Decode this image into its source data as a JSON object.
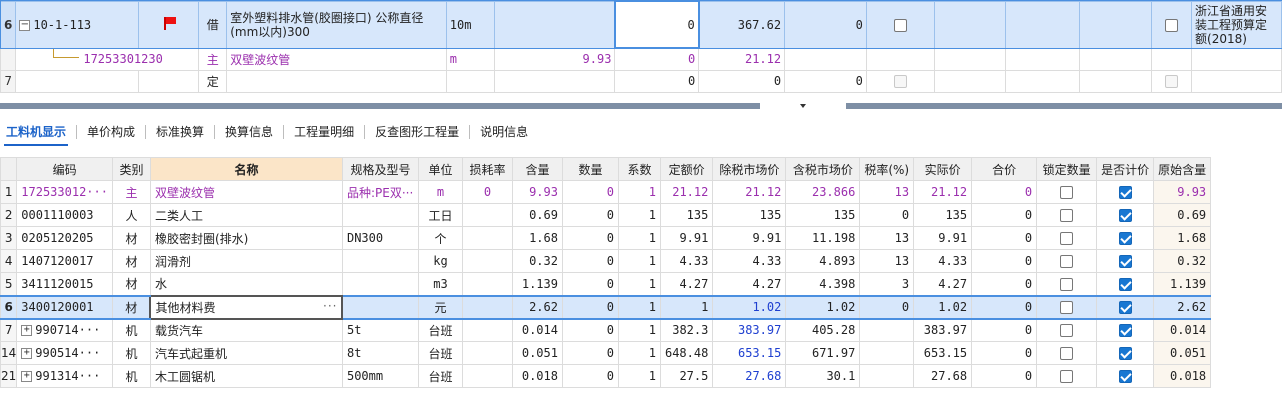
{
  "top_rows": [
    {
      "rowno": "6",
      "code": "10-1-113",
      "type": "借",
      "name": "室外塑料排水管(胶圈接口) 公称直径(mm以内)300",
      "unit": "10m",
      "qty": "",
      "val_a": "0",
      "val_b": "367.62",
      "val_c": "0",
      "std": "浙江省通用安装工程预算定额(2018)"
    },
    {
      "rowno": "",
      "code": "17253301230",
      "type": "主",
      "name": "双壁波纹管",
      "unit": "m",
      "qty": "9.93",
      "val_a": "0",
      "val_b": "21.12",
      "val_c": ""
    },
    {
      "rowno": "7",
      "code": "",
      "type": "定",
      "name": "",
      "unit": "",
      "qty": "",
      "val_a": "0",
      "val_b": "0",
      "val_c": "0"
    }
  ],
  "tabs": [
    "工料机显示",
    "单价构成",
    "标准换算",
    "换算信息",
    "工程量明细",
    "反查图形工程量",
    "说明信息"
  ],
  "columns": [
    "编码",
    "类别",
    "名称",
    "规格及型号",
    "单位",
    "损耗率",
    "含量",
    "数量",
    "系数",
    "定额价",
    "除税市场价",
    "含税市场价",
    "税率(%)",
    "实际价",
    "合价",
    "锁定数量",
    "是否计价",
    "原始含量"
  ],
  "rows": [
    {
      "no": "1",
      "code": "172533012···",
      "cat": "主",
      "name": "双壁波纹管",
      "spec": "品种:PE双···",
      "unit": "m",
      "loss": "0",
      "content": "9.93",
      "qty": "0",
      "coef": "1",
      "quota": "21.12",
      "ex_tax": "21.12",
      "in_tax": "23.866",
      "tax": "13",
      "actual": "21.12",
      "total": "0",
      "orig": "9.93"
    },
    {
      "no": "2",
      "code": "0001110003",
      "cat": "人",
      "name": "二类人工",
      "spec": "",
      "unit": "工日",
      "loss": "",
      "content": "0.69",
      "qty": "0",
      "coef": "1",
      "quota": "135",
      "ex_tax": "135",
      "in_tax": "135",
      "tax": "0",
      "actual": "135",
      "total": "0",
      "orig": "0.69"
    },
    {
      "no": "3",
      "code": "0205120205",
      "cat": "材",
      "name": "橡胶密封圈(排水)",
      "spec": "DN300",
      "unit": "个",
      "loss": "",
      "content": "1.68",
      "qty": "0",
      "coef": "1",
      "quota": "9.91",
      "ex_tax": "9.91",
      "in_tax": "11.198",
      "tax": "13",
      "actual": "9.91",
      "total": "0",
      "orig": "1.68"
    },
    {
      "no": "4",
      "code": "1407120017",
      "cat": "材",
      "name": "润滑剂",
      "spec": "",
      "unit": "kg",
      "loss": "",
      "content": "0.32",
      "qty": "0",
      "coef": "1",
      "quota": "4.33",
      "ex_tax": "4.33",
      "in_tax": "4.893",
      "tax": "13",
      "actual": "4.33",
      "total": "0",
      "orig": "0.32"
    },
    {
      "no": "5",
      "code": "3411120015",
      "cat": "材",
      "name": "水",
      "spec": "",
      "unit": "m3",
      "loss": "",
      "content": "1.139",
      "qty": "0",
      "coef": "1",
      "quota": "4.27",
      "ex_tax": "4.27",
      "in_tax": "4.398",
      "tax": "3",
      "actual": "4.27",
      "total": "0",
      "orig": "1.139"
    },
    {
      "no": "6",
      "code": "3400120001",
      "cat": "材",
      "name": "其他材料费",
      "spec": "",
      "unit": "元",
      "loss": "",
      "content": "2.62",
      "qty": "0",
      "coef": "1",
      "quota": "1",
      "ex_tax": "1.02",
      "in_tax": "1.02",
      "tax": "0",
      "actual": "1.02",
      "total": "0",
      "orig": "2.62"
    },
    {
      "no": "7",
      "code": "990714···",
      "cat": "机",
      "name": "载货汽车",
      "spec": "5t",
      "unit": "台班",
      "loss": "",
      "content": "0.014",
      "qty": "0",
      "coef": "1",
      "quota": "382.3",
      "ex_tax": "383.97",
      "in_tax": "405.28",
      "tax": "",
      "actual": "383.97",
      "total": "0",
      "orig": "0.014"
    },
    {
      "no": "14",
      "code": "990514···",
      "cat": "机",
      "name": "汽车式起重机",
      "spec": "8t",
      "unit": "台班",
      "loss": "",
      "content": "0.051",
      "qty": "0",
      "coef": "1",
      "quota": "648.48",
      "ex_tax": "653.15",
      "in_tax": "671.97",
      "tax": "",
      "actual": "653.15",
      "total": "0",
      "orig": "0.051"
    },
    {
      "no": "21",
      "code": "991314···",
      "cat": "机",
      "name": "木工圆锯机",
      "spec": "500mm",
      "unit": "台班",
      "loss": "",
      "content": "0.018",
      "qty": "0",
      "coef": "1",
      "quota": "27.5",
      "ex_tax": "27.68",
      "in_tax": "30.1",
      "tax": "",
      "actual": "27.68",
      "total": "0",
      "orig": "0.018"
    }
  ],
  "colors": {
    "selection": "#d7e7fb",
    "accent": "#1c63c9",
    "purple": "#9b2fae",
    "header_highlight": "#fbe5c8"
  }
}
